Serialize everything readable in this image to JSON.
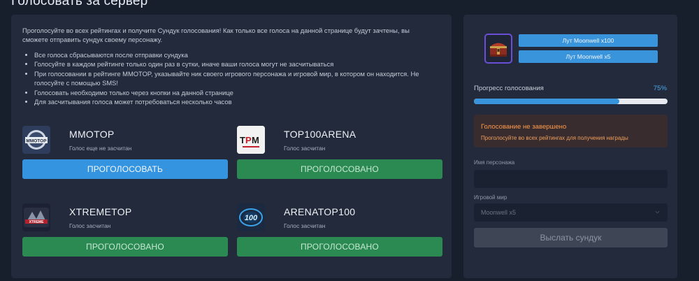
{
  "page": {
    "title": "Голосовать за сервер"
  },
  "vote_panel": {
    "intro": "Проголосуйте во всех рейтингах и получите Сундук голосования! Как только все голоса на данной странице будут зачтены, вы сможете отправить сундук своему персонажу.",
    "rules": [
      "Все голоса сбрасываются после отправки сундука",
      "Голосуйте в каждом рейтинге только один раз в сутки, иначе ваши голоса могут не засчитываться",
      "При голосовании в рейтинге MMOTOP, указывайте ник своего игрового персонажа и игровой мир, в котором он находится. Не голосуйте с помощью SMS!",
      "Голосовать необходимо только через кнопки на данной странице",
      "Для засчитывания голоса может потребоваться несколько часов"
    ],
    "sites": [
      {
        "name": "MMOTOP",
        "status": "Голос еще не засчитан",
        "button": "ПРОГОЛОСОВАТЬ",
        "logo": "mmotop-logo"
      },
      {
        "name": "TOP100ARENA",
        "status": "Голос засчитан",
        "button": "ПРОГОЛОСОВАНО",
        "logo": "top100arena-logo"
      },
      {
        "name": "XTREMETOP",
        "status": "Голос засчитан",
        "button": "ПРОГОЛОСОВАНО",
        "logo": "xtremetop-logo"
      },
      {
        "name": "ARENATOP100",
        "status": "Голос засчитан",
        "button": "ПРОГОЛОСОВАНО",
        "logo": "arenatop100-logo"
      }
    ]
  },
  "reward_panel": {
    "chest_icon": "treasure-chest-icon",
    "loot": [
      "Лут Moonwell x100",
      "Лут Moonwell x5"
    ],
    "progress": {
      "label": "Прогресс голосования",
      "value_text": "75%",
      "fraction": 0.75
    },
    "alert": {
      "title": "Голосование не завершено",
      "text": "Проголосуйте во всех рейтингах для получения награды"
    },
    "character": {
      "label": "Имя персонажа",
      "value": ""
    },
    "world": {
      "label": "Игровой мир",
      "value": "Moonwell x5"
    },
    "send_button": "Выслать сундук"
  },
  "colors": {
    "accent_blue": "#3594e0",
    "voted_green": "#2a8a52",
    "warning_orange": "#ff9b4a",
    "chest_border": "#6a4fd6"
  }
}
